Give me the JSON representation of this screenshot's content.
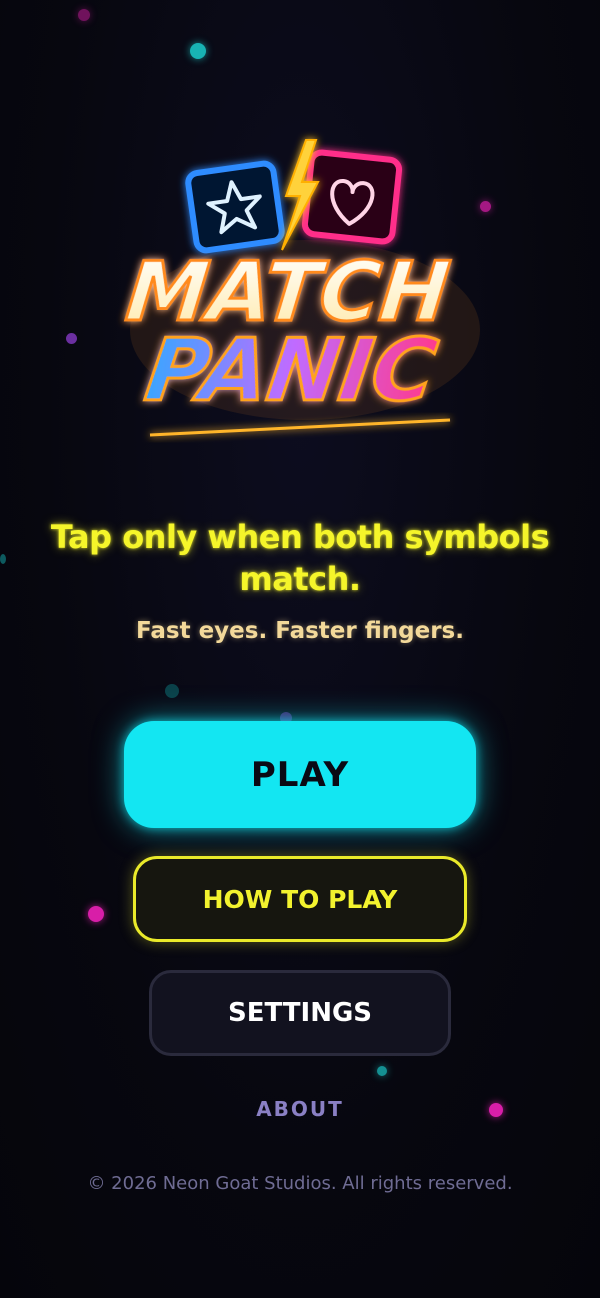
{
  "logo": {
    "line1": "MATCH",
    "line2": "PANIC",
    "left_symbol": "star-icon",
    "right_symbol": "heart-icon"
  },
  "tagline": "Tap only when both symbols match.",
  "subtagline": "Fast eyes. Faster fingers.",
  "menu": {
    "play_label": "PLAY",
    "how_to_play_label": "HOW TO PLAY",
    "settings_label": "SETTINGS",
    "about_label": "ABOUT"
  },
  "footer": "© 2026 Neon Goat Studios. All rights reserved.",
  "colors": {
    "background": "#07070f",
    "accent_cyan": "#13e6f2",
    "accent_yellow": "#f5f52a",
    "accent_magenta": "#ff2f8a",
    "accent_blue": "#2f8cff",
    "muted_violet": "#8a80c4"
  }
}
